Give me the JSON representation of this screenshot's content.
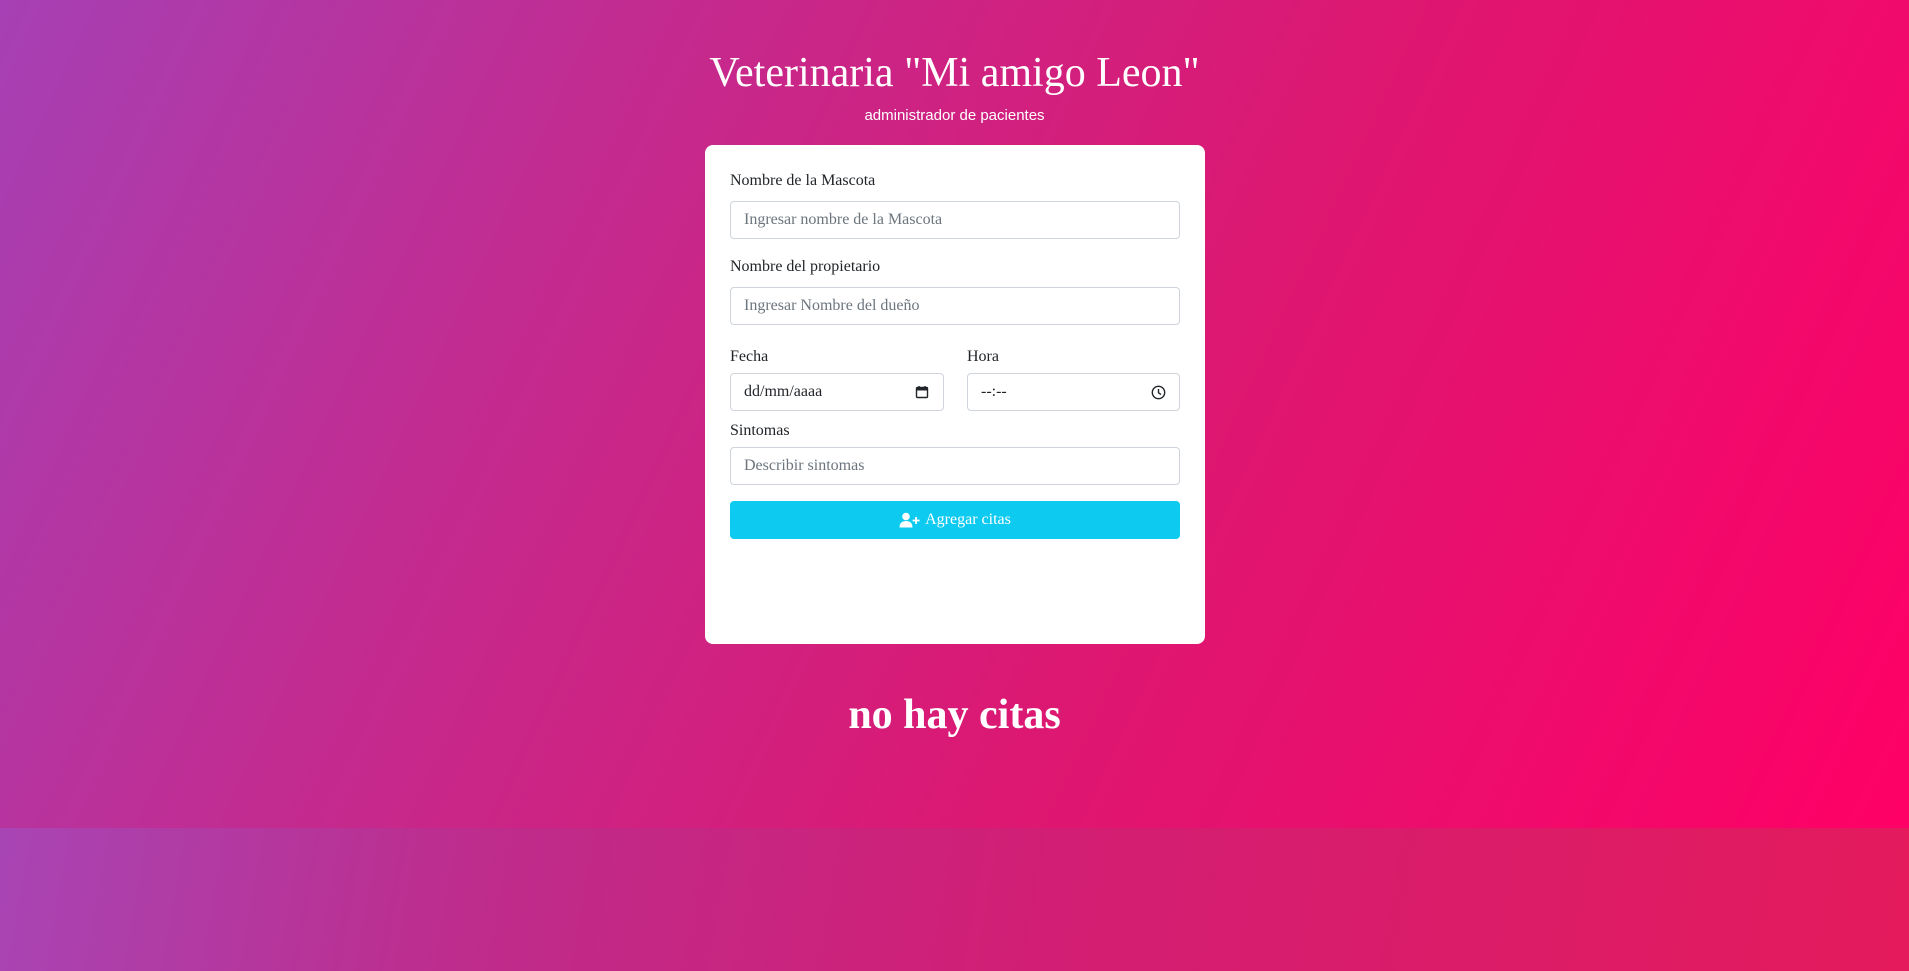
{
  "header": {
    "title": "Veterinaria \"Mi amigo Leon\"",
    "subtitle": "administrador de pacientes"
  },
  "form": {
    "pet_name": {
      "label": "Nombre de la Mascota",
      "placeholder": "Ingresar nombre de la Mascota",
      "value": ""
    },
    "owner_name": {
      "label": "Nombre del propietario",
      "placeholder": "Ingresar Nombre del dueño",
      "value": ""
    },
    "date": {
      "label": "Fecha",
      "display": "dd/mm/aaaa",
      "icon": "calendar-icon"
    },
    "time": {
      "label": "Hora",
      "display": "--:--",
      "icon": "clock-icon"
    },
    "symptoms": {
      "label": "Sintomas",
      "placeholder": "Describir sintomas",
      "value": ""
    },
    "submit": {
      "label": "Agregar citas",
      "icon": "user-plus-icon"
    }
  },
  "appointments": {
    "empty_message": "no hay citas"
  },
  "colors": {
    "button": "#0dcaf0",
    "gradient_start": "#a640b4",
    "gradient_end": "#ff0066"
  }
}
